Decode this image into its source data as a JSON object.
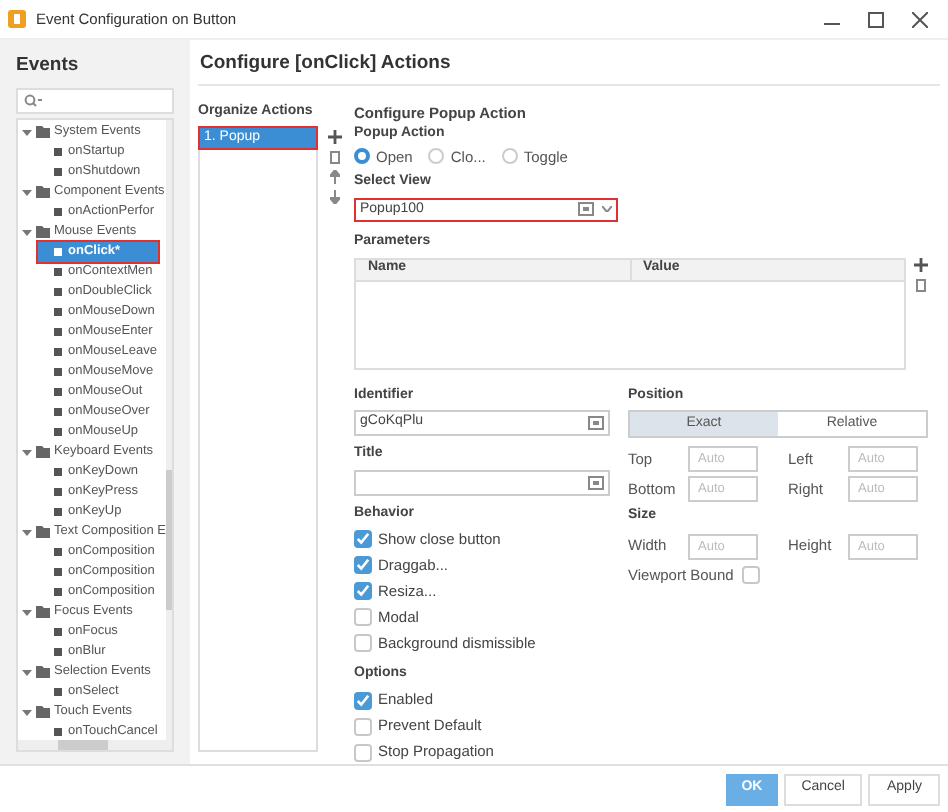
{
  "window": {
    "title": "Event Configuration on Button"
  },
  "events": {
    "title": "Events",
    "tree": [
      {
        "label": "System Events",
        "expanded": true,
        "children": [
          {
            "label": "onStartup",
            "selected": false
          },
          {
            "label": "onShutdown",
            "selected": false
          }
        ]
      },
      {
        "label": "Component Events",
        "expanded": true,
        "children": [
          {
            "label": "onActionPerfor",
            "selected": false
          }
        ]
      },
      {
        "label": "Mouse Events",
        "expanded": true,
        "children": [
          {
            "label": "onClick*",
            "selected": true
          },
          {
            "label": "onContextMen",
            "selected": false
          },
          {
            "label": "onDoubleClick",
            "selected": false
          },
          {
            "label": "onMouseDown",
            "selected": false
          },
          {
            "label": "onMouseEnter",
            "selected": false
          },
          {
            "label": "onMouseLeave",
            "selected": false
          },
          {
            "label": "onMouseMove",
            "selected": false
          },
          {
            "label": "onMouseOut",
            "selected": false
          },
          {
            "label": "onMouseOver",
            "selected": false
          },
          {
            "label": "onMouseUp",
            "selected": false
          }
        ]
      },
      {
        "label": "Keyboard Events",
        "expanded": true,
        "children": [
          {
            "label": "onKeyDown",
            "selected": false
          },
          {
            "label": "onKeyPress",
            "selected": false
          },
          {
            "label": "onKeyUp",
            "selected": false
          }
        ]
      },
      {
        "label": "Text Composition E",
        "expanded": true,
        "children": [
          {
            "label": "onComposition",
            "selected": false
          },
          {
            "label": "onComposition",
            "selected": false
          },
          {
            "label": "onComposition",
            "selected": false
          }
        ]
      },
      {
        "label": "Focus Events",
        "expanded": true,
        "children": [
          {
            "label": "onFocus",
            "selected": false
          },
          {
            "label": "onBlur",
            "selected": false
          }
        ]
      },
      {
        "label": "Selection Events",
        "expanded": true,
        "children": [
          {
            "label": "onSelect",
            "selected": false
          }
        ]
      },
      {
        "label": "Touch Events",
        "expanded": true,
        "children": [
          {
            "label": "onTouchCancel",
            "selected": false
          }
        ]
      }
    ]
  },
  "heading": "Configure [onClick] Actions",
  "organize": {
    "title": "Organize Actions",
    "items": [
      {
        "label": "1. Popup",
        "selected": true
      }
    ]
  },
  "config": {
    "title": "Configure Popup Action",
    "popup_action": {
      "label": "Popup Action",
      "options": [
        {
          "label": "Open",
          "selected": true
        },
        {
          "label": "Clo...",
          "selected": false
        },
        {
          "label": "Toggle",
          "selected": false
        }
      ]
    },
    "select_view": {
      "label": "Select View",
      "value": "Popup100",
      "highlighted": true
    },
    "parameters": {
      "label": "Parameters",
      "columns": [
        "Name",
        "Value"
      ]
    },
    "identifier": {
      "label": "Identifier",
      "value": "gCoKqPlu"
    },
    "title_field": {
      "label": "Title"
    },
    "behavior": {
      "label": "Behavior",
      "items": [
        {
          "label": "Show close button",
          "checked": true
        },
        {
          "label": "Draggab...",
          "checked": true
        },
        {
          "label": "Resiza...",
          "checked": true
        },
        {
          "label": "Modal",
          "checked": false
        },
        {
          "label": "Background dismissible",
          "checked": false
        }
      ]
    },
    "options": {
      "label": "Options",
      "items": [
        {
          "label": "Enabled",
          "checked": true
        },
        {
          "label": "Prevent Default",
          "checked": false
        },
        {
          "label": "Stop Propagation",
          "checked": false
        }
      ]
    },
    "position": {
      "label": "Position",
      "modes": [
        {
          "label": "Exact",
          "selected": true
        },
        {
          "label": "Relative",
          "selected": false
        }
      ],
      "fields": [
        {
          "label": "Top",
          "placeholder": "Auto"
        },
        {
          "label": "Left",
          "placeholder": "Auto"
        },
        {
          "label": "Bottom",
          "placeholder": "Auto"
        },
        {
          "label": "Right",
          "placeholder": "Auto"
        }
      ],
      "size_label": "Size",
      "size_fields": [
        {
          "label": "Width",
          "placeholder": "Auto"
        },
        {
          "label": "Height",
          "placeholder": "Auto"
        }
      ],
      "viewport_bound": {
        "label": "Viewport Bound",
        "checked": false
      }
    }
  },
  "buttons": [
    {
      "label": "OK",
      "kind": "primary"
    },
    {
      "label": "Cancel",
      "kind": "default"
    },
    {
      "label": "Apply",
      "kind": "default"
    }
  ]
}
